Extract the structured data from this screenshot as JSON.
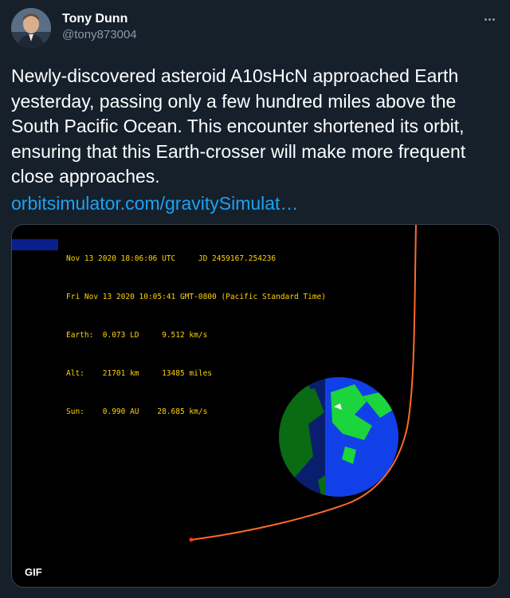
{
  "user": {
    "display_name": "Tony Dunn",
    "handle": "@tony873004"
  },
  "tweet": {
    "text": "Newly-discovered asteroid A10sHcN approached Earth yesterday, passing only a few hundred miles above the South Pacific Ocean. This encounter shortened its orbit, ensuring that this Earth-crosser will make more frequent close approaches.",
    "link": "orbitsimulator.com/gravitySimulat…"
  },
  "media": {
    "badge": "GIF",
    "overlay": {
      "line1": "Nov 13 2020 18:06:06 UTC     JD 2459167.254236",
      "line2": "Fri Nov 13 2020 10:05:41 GMT-0800 (Pacific Standard Time)",
      "line3": "Earth:  0.073 LD     9.512 km/s",
      "line4": "Alt:    21701 km     13485 miles",
      "line5": "Sun:    0.990 AU    28.685 km/s"
    }
  },
  "colors": {
    "background": "#15202b",
    "link": "#1da1f2",
    "secondary_text": "#8899a6",
    "overlay_text": "#ffd400",
    "orbit": "#ff6a2a"
  },
  "icons": {
    "more": "more-horizontal-icon"
  }
}
